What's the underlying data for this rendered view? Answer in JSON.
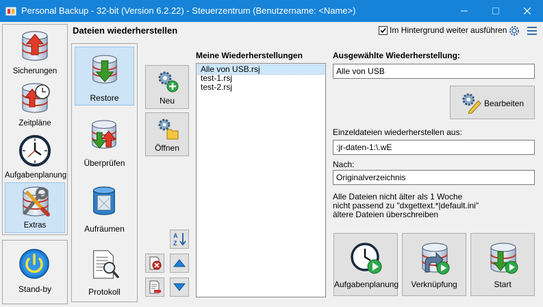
{
  "window": {
    "title": "Personal Backup - 32-bit (Version 6.2.22) - Steuerzentrum (Benutzername: <Name>)",
    "title_bg": "#1683d8"
  },
  "nav": {
    "items": [
      {
        "label": "Sicherungen",
        "icon": "database-up-icon"
      },
      {
        "label": "Zeitpläne",
        "icon": "database-clock-icon"
      },
      {
        "label": "Aufgabenplanung",
        "icon": "clock-icon"
      },
      {
        "label": "Extras",
        "icon": "tools-icon",
        "active": true
      }
    ],
    "standby": {
      "label": "Stand-by",
      "icon": "power-icon"
    }
  },
  "header": {
    "title": "Dateien wiederherstellen",
    "background_checkbox": {
      "label": "Im Hintergrund weiter ausführen",
      "checked": true
    }
  },
  "subnav": {
    "items": [
      {
        "label": "Restore",
        "active": true
      },
      {
        "label": "Überprüfen"
      },
      {
        "label": "Aufräumen"
      },
      {
        "label": "Protokoll"
      }
    ]
  },
  "actions": {
    "new_label": "Neu",
    "open_label": "Öffnen"
  },
  "restores": {
    "label": "Meine Wiederherstellungen",
    "items": [
      "Alle von USB.rsj",
      "test-1.rsj",
      "test-2.rsj"
    ],
    "selected_index": 0
  },
  "detail": {
    "selected_label": "Ausgewählte Wiederherstellung:",
    "selected_value": "Alle von USB",
    "edit_label": "Bearbeiten",
    "source_label": "Einzeldateien wiederherstellen aus:",
    "source_value": ":jr-daten-1:\\.wE",
    "target_label": "Nach:",
    "target_value": "Originalverzeichnis",
    "info_lines": [
      "Alle Dateien nicht älter als 1 Woche",
      "nicht passend zu \"dxgettext.*|default.ini\"",
      "ältere Dateien überschreiben"
    ]
  },
  "bottom": {
    "schedule_label": "Aufgabenplanung",
    "shortcut_label": "Verknüpfung",
    "start_label": "Start"
  },
  "colors": {
    "selection": "#cde3f6",
    "arrow_blue": "#1e7fd6",
    "arrow_green": "#3a9a2a",
    "arrow_red": "#d62b2b"
  }
}
